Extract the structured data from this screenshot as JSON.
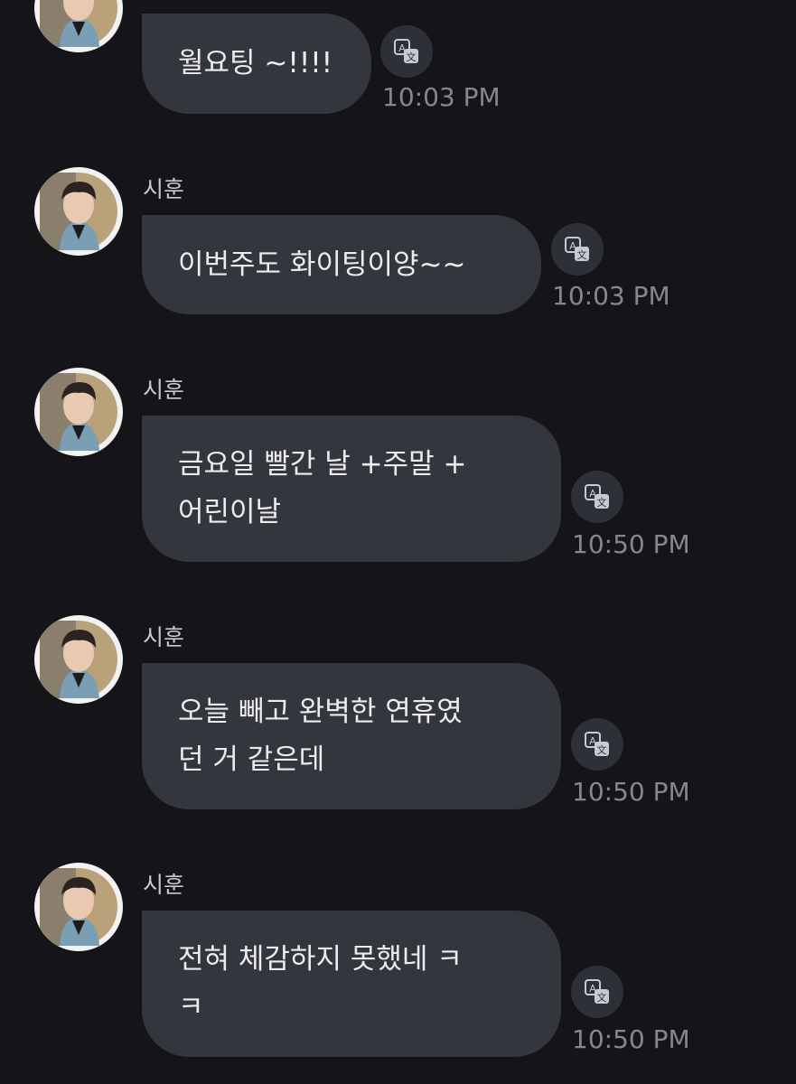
{
  "messages": [
    {
      "sender": "",
      "text": "월요팅 ~!!!!",
      "time": "10:03 PM"
    },
    {
      "sender": "시훈",
      "text": "이번주도 화이팅이양~~",
      "time": "10:03 PM"
    },
    {
      "sender": "시훈",
      "text": "금요일 빨간 날 +주말 +\n어린이날",
      "time": "10:50 PM"
    },
    {
      "sender": "시훈",
      "text": "오늘 빼고 완벽한 연휴였\n던 거 같은데",
      "time": "10:50 PM"
    },
    {
      "sender": "시훈",
      "text": "전혀 체감하지 못했네 ㅋ\nㅋ",
      "time": "10:50 PM"
    }
  ],
  "icons": {
    "translate": "translate-icon",
    "avatar": "avatar"
  },
  "colors": {
    "background": "#141419",
    "bubble": "#34363d",
    "text": "#ececf0",
    "timestamp": "#85868f"
  }
}
